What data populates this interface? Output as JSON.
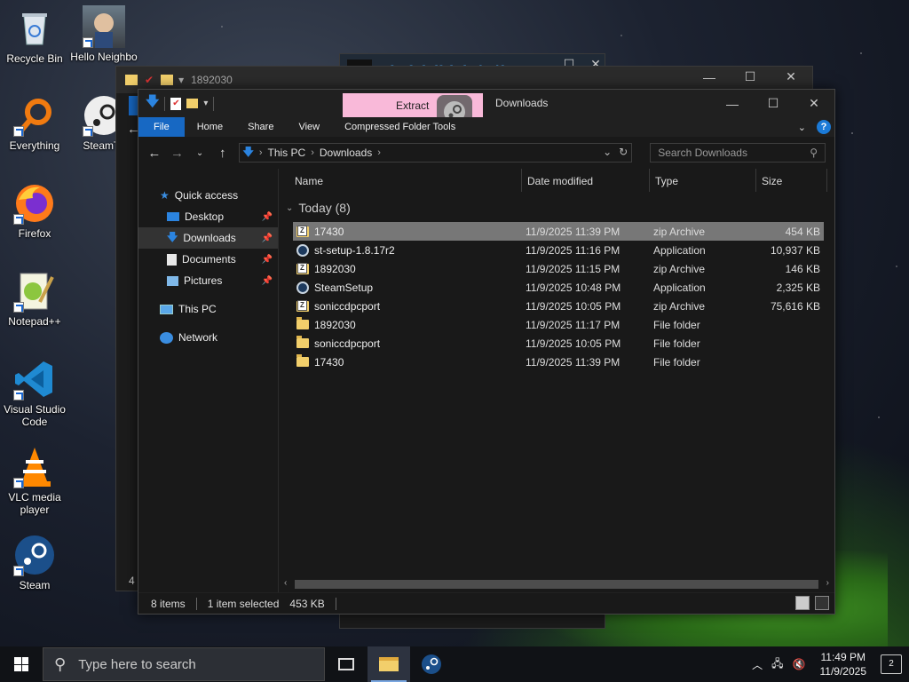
{
  "desktop": {
    "icons": [
      {
        "label": "Recycle Bin"
      },
      {
        "label": "Hello Neighbo"
      },
      {
        "label": "Everything"
      },
      {
        "label": "SteamTo"
      },
      {
        "label": "Firefox"
      },
      {
        "label": "Notepad++"
      },
      {
        "label": "Visual Studio Code"
      },
      {
        "label": "VLC media player"
      },
      {
        "label": "Steam"
      }
    ]
  },
  "back_window_1": {
    "title": "1892030",
    "status_fragment": "4"
  },
  "back_window_2": {
    "title": "vfrgfvfvffrfgfedvdf"
  },
  "explorer": {
    "title": "Downloads",
    "extract_tab": "Extract",
    "ribbon_tabs": [
      "File",
      "Home",
      "Share",
      "View",
      "Compressed Folder Tools"
    ],
    "help_label": "?",
    "address": {
      "root": "This PC",
      "current": "Downloads"
    },
    "search_placeholder": "Search Downloads",
    "nav": {
      "quick_access": "Quick access",
      "desktop": "Desktop",
      "downloads": "Downloads",
      "documents": "Documents",
      "pictures": "Pictures",
      "this_pc": "This PC",
      "network": "Network"
    },
    "columns": {
      "name": "Name",
      "date": "Date modified",
      "type": "Type",
      "size": "Size"
    },
    "group_label": "Today (8)",
    "files": [
      {
        "name": "17430",
        "date": "11/9/2025 11:39 PM",
        "type": "zip Archive",
        "size": "454 KB",
        "icon": "zip-icon",
        "selected": true
      },
      {
        "name": "st-setup-1.8.17r2",
        "date": "11/9/2025 11:16 PM",
        "type": "Application",
        "size": "10,937 KB",
        "icon": "app-icon",
        "selected": false
      },
      {
        "name": "1892030",
        "date": "11/9/2025 11:15 PM",
        "type": "zip Archive",
        "size": "146 KB",
        "icon": "zip-icon",
        "selected": false
      },
      {
        "name": "SteamSetup",
        "date": "11/9/2025 10:48 PM",
        "type": "Application",
        "size": "2,325 KB",
        "icon": "app-icon",
        "selected": false
      },
      {
        "name": "soniccdpcport",
        "date": "11/9/2025 10:05 PM",
        "type": "zip Archive",
        "size": "75,616 KB",
        "icon": "zip-icon",
        "selected": false
      },
      {
        "name": "1892030",
        "date": "11/9/2025 11:17 PM",
        "type": "File folder",
        "size": "",
        "icon": "folder-icon",
        "selected": false
      },
      {
        "name": "soniccdpcport",
        "date": "11/9/2025 10:05 PM",
        "type": "File folder",
        "size": "",
        "icon": "folder-icon",
        "selected": false
      },
      {
        "name": "17430",
        "date": "11/9/2025 11:39 PM",
        "type": "File folder",
        "size": "",
        "icon": "folder-icon",
        "selected": false
      }
    ],
    "status": {
      "items": "8 items",
      "selected": "1 item selected",
      "selected_size": "453 KB"
    }
  },
  "taskbar": {
    "search_placeholder": "Type here to search",
    "time": "11:49 PM",
    "date": "11/9/2025",
    "notification_count": "2"
  }
}
